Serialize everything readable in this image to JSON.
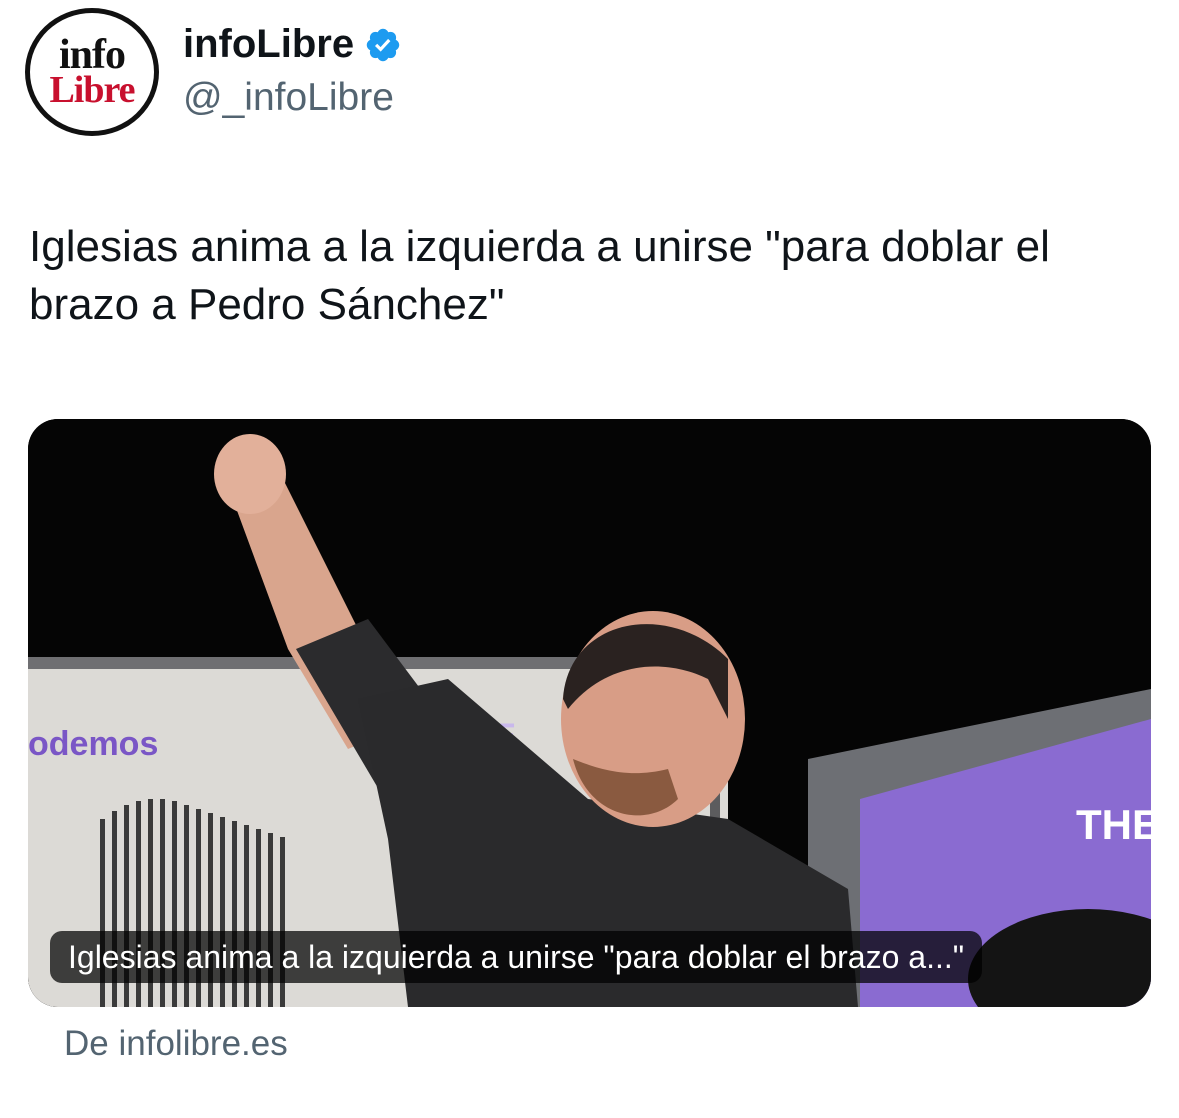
{
  "account": {
    "avatar_logo_top": "info",
    "avatar_logo_bottom": "Libre",
    "display_name": "infoLibre",
    "handle": "@_infoLibre",
    "verified": true,
    "verified_icon": "verified-badge-icon"
  },
  "tweet": {
    "text": "Iglesias anima a la izquierda a unirse \"para doblar el brazo a Pedro Sánchez\""
  },
  "link_card": {
    "caption": "Iglesias anima a la izquierda a unirse \"para doblar el brazo a...\"",
    "image_banner_left_text": "odemos",
    "image_banner_mid_text": "THE",
    "image_banner_right_text": "THE",
    "source_prefix": "De",
    "source_domain": "infolibre.es"
  },
  "colors": {
    "brand_red": "#c8102e",
    "verified_blue": "#1d9bf0",
    "text_primary": "#0f1419",
    "text_secondary": "#536471",
    "banner_purple": "#8a6bd1"
  }
}
